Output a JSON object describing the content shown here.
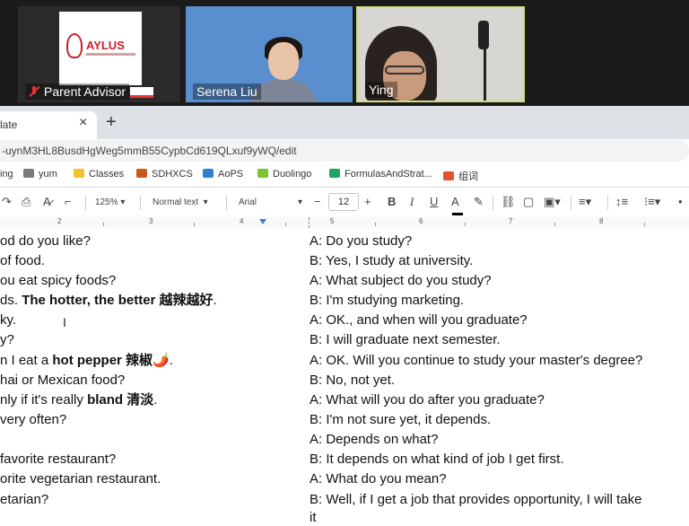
{
  "video": {
    "participants": [
      {
        "name": "Parent Advisor",
        "muted": true
      },
      {
        "name": "Serena Liu"
      },
      {
        "name": "Ying"
      }
    ],
    "logo_text": "AYLUS"
  },
  "browser": {
    "tab_title": "late",
    "tab_close": "×",
    "new_tab": "+",
    "url": "-uynM3HL8BusdHgWeg5mmB55CypbCd619QLxuf9yWQ/edit"
  },
  "bookmarks": [
    {
      "label": "ing",
      "color": "#888888"
    },
    {
      "label": "yum",
      "color": "#7a7a7a"
    },
    {
      "label": "Classes",
      "color": "#f2c230"
    },
    {
      "label": "SDHXCS",
      "color": "#c75a1a"
    },
    {
      "label": "AoPS",
      "color": "#2f7fd1"
    },
    {
      "label": "Duolingo",
      "color": "#7dc42f"
    },
    {
      "label": "FormulasAndStrat...",
      "color": "#1fa463"
    },
    {
      "label": "组词",
      "color": "#e2532b"
    }
  ],
  "toolbar": {
    "zoom": "125%",
    "style": "Normal text",
    "font": "Arial",
    "font_size": "12",
    "minus": "−",
    "plus": "+",
    "bold": "B",
    "italic": "I",
    "underline": "U",
    "text_color": "A"
  },
  "ruler": [
    "2",
    "3",
    "4",
    "5",
    "6",
    "7",
    "8"
  ],
  "left_column": [
    {
      "text": "od do you like?"
    },
    {
      "text": "of food."
    },
    {
      "text": "ou eat spicy foods?"
    },
    {
      "pre": "ds. ",
      "bold": "The hotter, the better 越辣越好",
      "post": "."
    },
    {
      "text": "ky."
    },
    {
      "text": "y?"
    },
    {
      "pre": "n I eat a ",
      "bold": "hot pepper 辣椒",
      "post": "🌶️."
    },
    {
      "text": "hai or Mexican food?"
    },
    {
      "pre": "nly if it's really ",
      "bold": "bland 清淡",
      "post": "."
    },
    {
      "text": " very often?"
    },
    {
      "text": ""
    },
    {
      "text": " favorite restaurant?"
    },
    {
      "text": "orite vegetarian restaurant."
    },
    {
      "text": "etarian?"
    }
  ],
  "right_column": [
    "A: Do you study?",
    "B: Yes, I study at university.",
    "A: What subject do you study?",
    "B: I'm studying marketing.",
    "A: OK., and when will you graduate?",
    "B: I will graduate next semester.",
    "A: OK. Will you continue to study your master's degree?",
    "B: No, not yet.",
    "A:  What will you do after you graduate?",
    "B: I'm not sure yet, it depends.",
    "A: Depends on what?",
    "B: It depends on what kind of job I get first.",
    "A: What do you mean?",
    "B: Well, if I get a job that provides opportunity, I will take",
    "it"
  ]
}
